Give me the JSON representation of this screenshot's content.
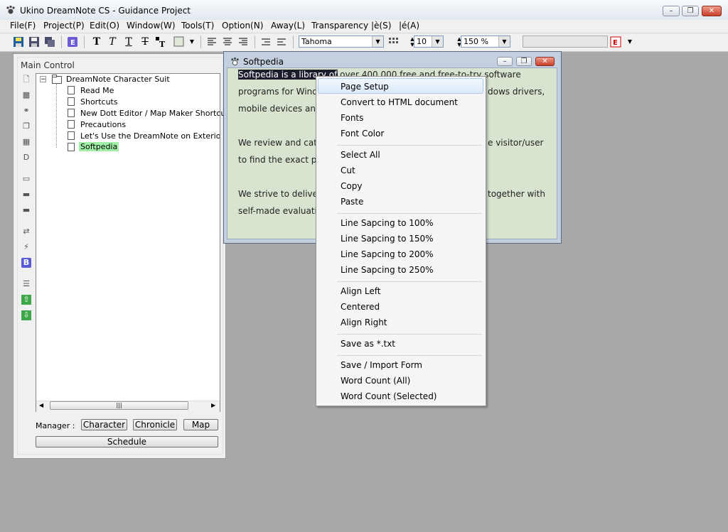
{
  "app": {
    "title": "Ukino DreamNote CS - Guidance Project"
  },
  "menu": [
    "File(F)",
    "Project(P)",
    "Edit(O)",
    "Window(W)",
    "Tools(T)",
    "Option(N)",
    "Away(L)",
    "Transparency",
    "|è(S)",
    "|é(A)"
  ],
  "toolbar": {
    "bold_glyph": "T",
    "font_name": "Tahoma",
    "font_size": "10",
    "zoom": "150 %"
  },
  "panel": {
    "title": "Main Control",
    "tree": {
      "root": "DreamNote Character Suit",
      "items": [
        "Read Me",
        "Shortcuts",
        "New Dott Editor / Map Maker Shortcuts",
        "Precautions",
        "Let's Use the DreamNote on Exterior Com",
        "Softpedia"
      ],
      "selected": "Softpedia"
    },
    "manager_label": "Manager :",
    "buttons": [
      "Character",
      "Chronicle",
      "Map"
    ],
    "schedule": "Schedule"
  },
  "child": {
    "title": "Softpedia",
    "lines": [
      "Softpedia is a library of over 400,000 free and free-to-try software",
      "programs for Windo",
      "mobile devices and",
      "We review and cate",
      "to find the exact pr",
      "We strive to deliver",
      "self-made evaluatio"
    ],
    "right_fragments": [
      "dows drivers,",
      "e visitor/user",
      "together with"
    ]
  },
  "context_menu": {
    "items": [
      [
        "Page Setup",
        "Convert to HTML document",
        "Fonts",
        "Font Color"
      ],
      [
        "Select All",
        "Cut",
        "Copy",
        "Paste"
      ],
      [
        "Line Sapcing to 100%",
        "Line Sapcing to 150%",
        "Line Sapcing to 200%",
        "Line Sapcing to 250%"
      ],
      [
        "Align Left",
        "Centered",
        "Align Right"
      ],
      [
        "Save as *.txt"
      ],
      [
        "Save / Import Form",
        "Word Count (All)",
        "Word Count (Selected)"
      ]
    ],
    "highlighted": "Page Setup"
  },
  "colors": {
    "desktop": "#a9a9a9",
    "selected_tree": "#9ff0a6",
    "note_bg": "#d8e3d0"
  }
}
